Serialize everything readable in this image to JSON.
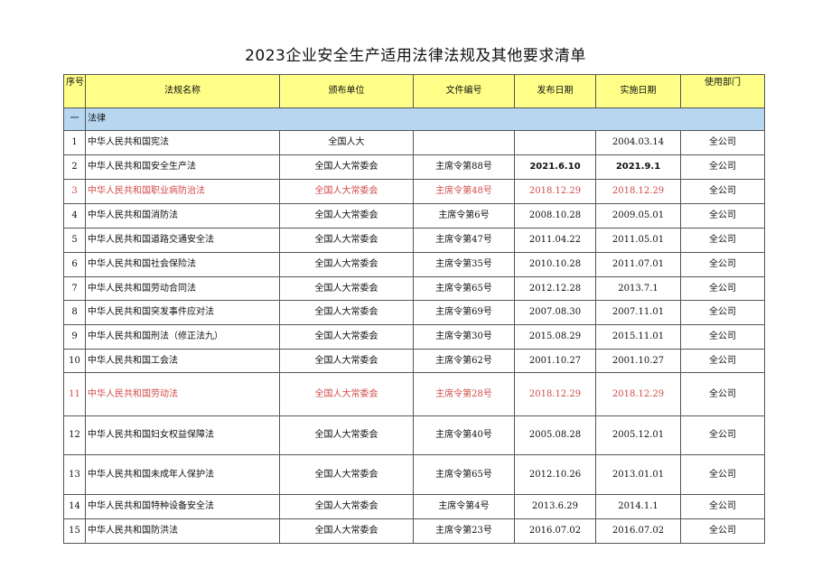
{
  "title": "2023企业安全生产适用法律法规及其他要求清单",
  "headers": {
    "seq": "序号",
    "name": "法规名称",
    "issuer": "颁布单位",
    "doc_no": "文件编号",
    "publish_date": "发布日期",
    "effective_date": "实施日期",
    "dept": "使用部门"
  },
  "section": {
    "seq": "一",
    "label": "法律"
  },
  "rows": [
    {
      "seq": "1",
      "name": "中华人民共和国宪法",
      "issuer": "全国人大",
      "doc_no": "",
      "publish_date": "",
      "effective_date": "2004.03.14",
      "dept": "全公司"
    },
    {
      "seq": "2",
      "name": "中华人民共和国安全生产法",
      "issuer": "全国人大常委会",
      "doc_no": "主席令第88号",
      "publish_date": "2021.6.10",
      "effective_date": "2021.9.1",
      "dept": "全公司"
    },
    {
      "seq": "3",
      "name": "中华人民共和国职业病防治法",
      "issuer": "全国人大常委会",
      "doc_no": "主席令第48号",
      "publish_date": "2018.12.29",
      "effective_date": "2018.12.29",
      "dept": "全公司"
    },
    {
      "seq": "4",
      "name": "中华人民共和国消防法",
      "issuer": "全国人大常委会",
      "doc_no": "主席令第6号",
      "publish_date": "2008.10.28",
      "effective_date": "2009.05.01",
      "dept": "全公司"
    },
    {
      "seq": "5",
      "name": "中华人民共和国道路交通安全法",
      "issuer": "全国人大常委会",
      "doc_no": "主席令第47号",
      "publish_date": "2011.04.22",
      "effective_date": "2011.05.01",
      "dept": "全公司"
    },
    {
      "seq": "6",
      "name": "中华人民共和国社会保险法",
      "issuer": "全国人大常委会",
      "doc_no": "主席令第35号",
      "publish_date": "2010.10.28",
      "effective_date": "2011.07.01",
      "dept": "全公司"
    },
    {
      "seq": "7",
      "name": "中华人民共和国劳动合同法",
      "issuer": "全国人大常委会",
      "doc_no": "主席令第65号",
      "publish_date": "2012.12.28",
      "effective_date": "2013.7.1",
      "dept": "全公司"
    },
    {
      "seq": "8",
      "name": "中华人民共和国突发事件应对法",
      "issuer": "全国人大常委会",
      "doc_no": "主席令第69号",
      "publish_date": "2007.08.30",
      "effective_date": "2007.11.01",
      "dept": "全公司"
    },
    {
      "seq": "9",
      "name": "中华人民共和国刑法（修正法九）",
      "issuer": "全国人大常委会",
      "doc_no": "主席令第30号",
      "publish_date": "2015.08.29",
      "effective_date": "2015.11.01",
      "dept": "全公司"
    },
    {
      "seq": "10",
      "name": "中华人民共和国工会法",
      "issuer": "全国人大常委会",
      "doc_no": "主席令第62号",
      "publish_date": "2001.10.27",
      "effective_date": "2001.10.27",
      "dept": "全公司"
    },
    {
      "seq": "11",
      "name": "中华人民共和国劳动法",
      "issuer": "全国人大常委会",
      "doc_no": "主席令第28号",
      "publish_date": "2018.12.29",
      "effective_date": "2018.12.29",
      "dept": "全公司"
    },
    {
      "seq": "12",
      "name": "中华人民共和国妇女权益保障法",
      "issuer": "全国人大常委会",
      "doc_no": "主席令第40号",
      "publish_date": "2005.08.28",
      "effective_date": "2005.12.01",
      "dept": "全公司"
    },
    {
      "seq": "13",
      "name": "中华人民共和国未成年人保护法",
      "issuer": "全国人大常委会",
      "doc_no": "主席令第65号",
      "publish_date": "2012.10.26",
      "effective_date": "2013.01.01",
      "dept": "全公司"
    },
    {
      "seq": "14",
      "name": "中华人民共和国特种设备安全法",
      "issuer": "全国人大常委会",
      "doc_no": "主席令第4号",
      "publish_date": "2013.6.29",
      "effective_date": "2014.1.1",
      "dept": "全公司"
    },
    {
      "seq": "15",
      "name": "中华人民共和国防洪法",
      "issuer": "全国人大常委会",
      "doc_no": "主席令第23号",
      "publish_date": "2016.07.02",
      "effective_date": "2016.07.02",
      "dept": "全公司"
    }
  ],
  "colors": {
    "header_fill": "#ffff88",
    "section_fill": "#b7d7f1",
    "highlight_text": "#d24b4b"
  }
}
